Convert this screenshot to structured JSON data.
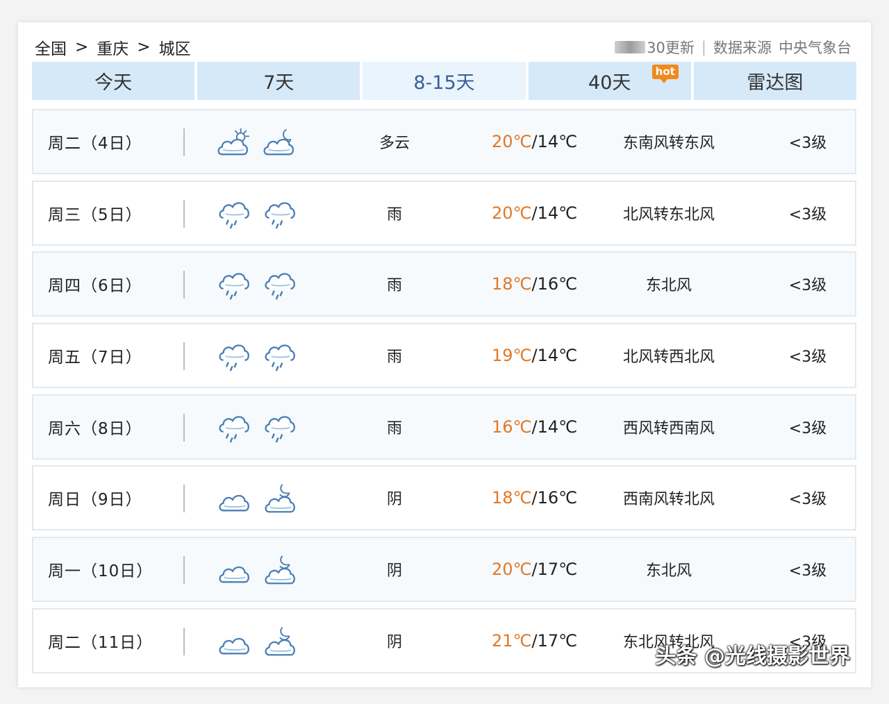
{
  "breadcrumb": [
    "全国",
    "重庆",
    "城区"
  ],
  "breadcrumb_sep": ">",
  "header_meta": {
    "update_text": "30更新",
    "source_label": "数据来源",
    "source": "中央气象台"
  },
  "tabs": [
    {
      "label": "今天"
    },
    {
      "label": "7天"
    },
    {
      "label": "8-15天",
      "active": true
    },
    {
      "label": "40天",
      "badge": "hot"
    },
    {
      "label": "雷达图"
    }
  ],
  "forecast": [
    {
      "day": "周二（4日）",
      "icons": [
        "partly-cloudy-day-icon",
        "partly-cloudy-night-icon"
      ],
      "condition": "多云",
      "high": "20℃",
      "low": "14℃",
      "wind": "东南风转东风",
      "level": "<3级"
    },
    {
      "day": "周三（5日）",
      "icons": [
        "rain-icon",
        "rain-icon"
      ],
      "condition": "雨",
      "high": "20℃",
      "low": "14℃",
      "wind": "北风转东北风",
      "level": "<3级"
    },
    {
      "day": "周四（6日）",
      "icons": [
        "rain-icon",
        "rain-icon"
      ],
      "condition": "雨",
      "high": "18℃",
      "low": "16℃",
      "wind": "东北风",
      "level": "<3级"
    },
    {
      "day": "周五（7日）",
      "icons": [
        "rain-icon",
        "rain-icon"
      ],
      "condition": "雨",
      "high": "19℃",
      "low": "14℃",
      "wind": "北风转西北风",
      "level": "<3级"
    },
    {
      "day": "周六（8日）",
      "icons": [
        "rain-icon",
        "rain-icon"
      ],
      "condition": "雨",
      "high": "16℃",
      "low": "14℃",
      "wind": "西风转西南风",
      "level": "<3级"
    },
    {
      "day": "周日（9日）",
      "icons": [
        "overcast-icon",
        "overcast-night-icon"
      ],
      "condition": "阴",
      "high": "18℃",
      "low": "16℃",
      "wind": "西南风转北风",
      "level": "<3级"
    },
    {
      "day": "周一（10日）",
      "icons": [
        "overcast-icon",
        "overcast-night-icon"
      ],
      "condition": "阴",
      "high": "20℃",
      "low": "17℃",
      "wind": "东北风",
      "level": "<3级"
    },
    {
      "day": "周二（11日）",
      "icons": [
        "overcast-icon",
        "overcast-night-icon"
      ],
      "condition": "阴",
      "high": "21℃",
      "low": "17℃",
      "wind": "东北风转北风",
      "level": "<3级"
    }
  ],
  "temp_separator": "/",
  "watermark": "头条 @光线摄影世界",
  "colors": {
    "tab_bg": "#d6e9f9",
    "tab_active_text": "#3a5e97",
    "high_temp": "#e07826",
    "icon_stroke": "#4a7fb5"
  }
}
